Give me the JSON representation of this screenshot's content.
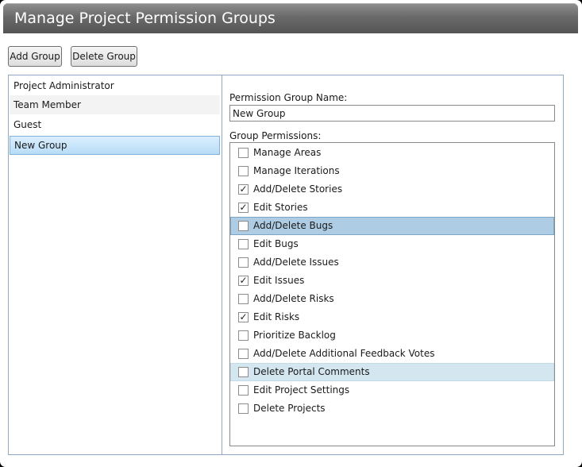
{
  "window": {
    "title": "Manage Project Permission Groups"
  },
  "toolbar": {
    "add_label": "Add Group",
    "delete_label": "Delete Group"
  },
  "groups": [
    {
      "label": "Project Administrator"
    },
    {
      "label": "Team Member"
    },
    {
      "label": "Guest"
    },
    {
      "label": "New Group",
      "selected": true
    }
  ],
  "editor": {
    "name_label": "Permission Group Name:",
    "name_value": "New Group",
    "permissions_label": "Group Permissions:"
  },
  "permissions": [
    {
      "label": "Manage Areas",
      "checked": false
    },
    {
      "label": "Manage Iterations",
      "checked": false
    },
    {
      "label": "Add/Delete Stories",
      "checked": true
    },
    {
      "label": "Edit Stories",
      "checked": true
    },
    {
      "label": "Add/Delete Bugs",
      "checked": false,
      "state": "selected"
    },
    {
      "label": "Edit Bugs",
      "checked": false
    },
    {
      "label": "Add/Delete Issues",
      "checked": false
    },
    {
      "label": "Edit Issues",
      "checked": true
    },
    {
      "label": "Add/Delete Risks",
      "checked": false
    },
    {
      "label": "Edit Risks",
      "checked": true
    },
    {
      "label": "Prioritize Backlog",
      "checked": false
    },
    {
      "label": "Add/Delete Additional Feedback Votes",
      "checked": false
    },
    {
      "label": "Delete Portal Comments",
      "checked": false,
      "state": "hover"
    },
    {
      "label": "Edit Project Settings",
      "checked": false
    },
    {
      "label": "Delete Projects",
      "checked": false
    }
  ],
  "colors": {
    "title_bar": "#6a6a6a",
    "selection": "#aecde4",
    "hover": "#d4e7f1",
    "border": "#8fa9c4"
  },
  "icons": {
    "checked": "check-mark-icon"
  }
}
